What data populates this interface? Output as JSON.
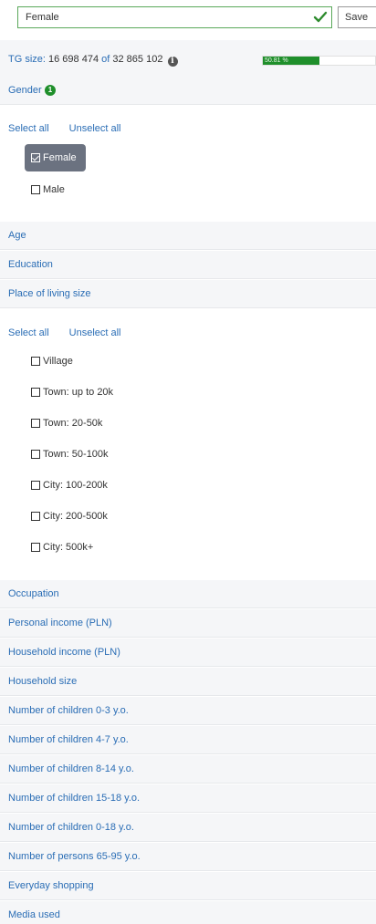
{
  "top": {
    "name_value": "Female",
    "save_label": "Save"
  },
  "tg": {
    "label": "TG size:",
    "size": "16 698 474",
    "of": "of",
    "total": "32 865 102",
    "percent_text": "50.81 %",
    "percent_value": 0.5081,
    "info_icon": "i"
  },
  "colors": {
    "accent": "#2a6db5",
    "success": "#1f8f2b",
    "selected_bg": "#6b7280"
  },
  "gender": {
    "label": "Gender",
    "badge": "1",
    "select_all": "Select all",
    "unselect_all": "Unselect all",
    "options": [
      "Female",
      "Male"
    ]
  },
  "collapsed_1": [
    "Age",
    "Education",
    "Place of living size"
  ],
  "place": {
    "select_all": "Select all",
    "unselect_all": "Unselect all",
    "options": [
      "Village",
      "Town: up to 20k",
      "Town: 20-50k",
      "Town: 50-100k",
      "City: 100-200k",
      "City: 200-500k",
      "City: 500k+"
    ]
  },
  "collapsed_2": [
    "Occupation",
    "Personal income (PLN)",
    "Household income (PLN)",
    "Household size",
    "Number of children 0-3 y.o.",
    "Number of children 4-7 y.o.",
    "Number of children 8-14 y.o.",
    "Number of children 15-18 y.o.",
    "Number of children 0-18 y.o.",
    "Number of persons 65-95 y.o.",
    "Everyday shopping",
    "Media used"
  ]
}
